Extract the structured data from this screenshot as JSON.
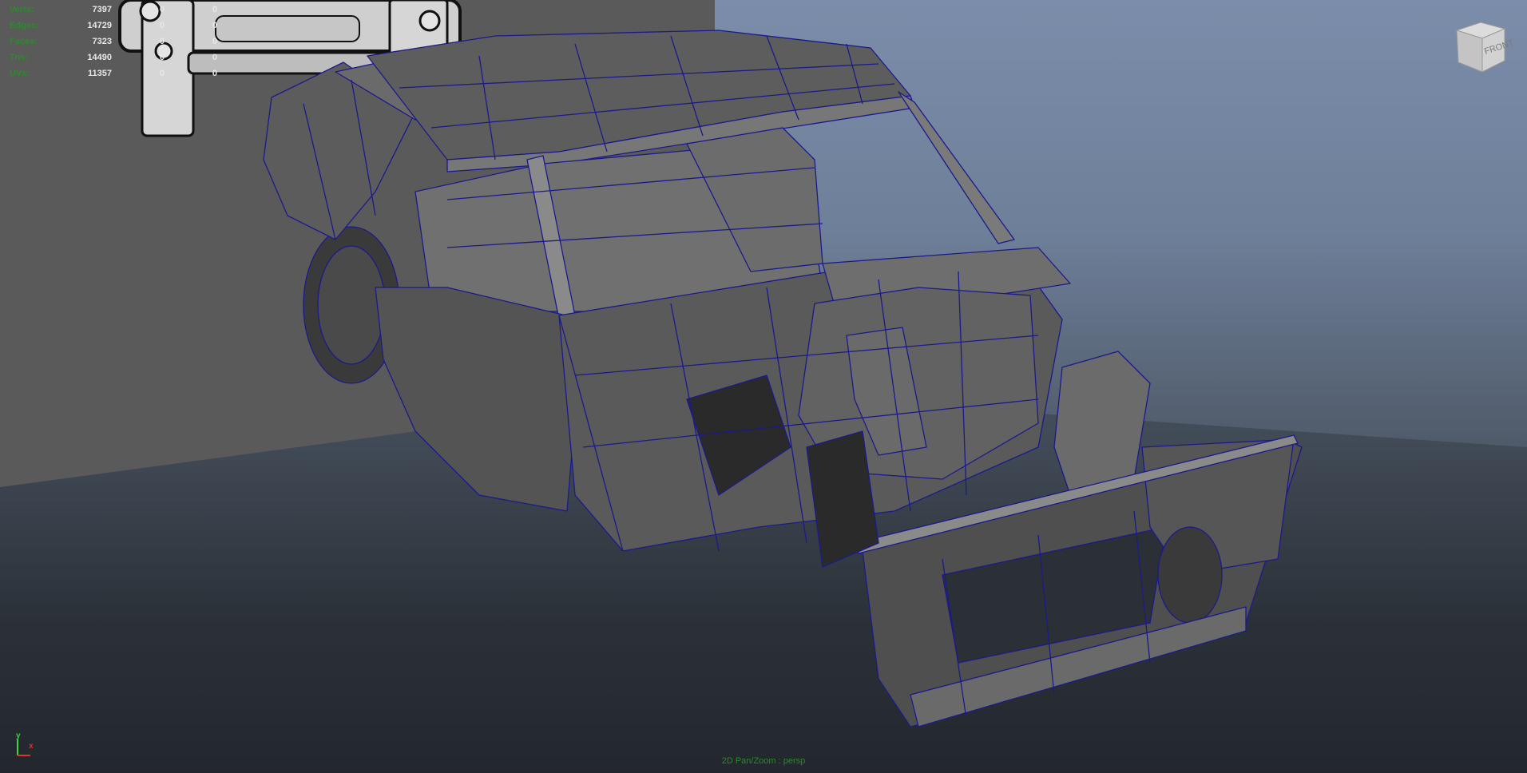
{
  "hud": {
    "rows": [
      {
        "label": "Verts:",
        "value": "7397",
        "selected": "0",
        "uv": "0"
      },
      {
        "label": "Edges:",
        "value": "14729",
        "selected": "0",
        "uv": "0"
      },
      {
        "label": "Faces:",
        "value": "7323",
        "selected": "0",
        "uv": "0"
      },
      {
        "label": "Tris:",
        "value": "14490",
        "selected": "0",
        "uv": "0"
      },
      {
        "label": "UVs:",
        "value": "11357",
        "selected": "0",
        "uv": "0"
      }
    ]
  },
  "viewcube": {
    "face_label": "FRONT"
  },
  "camera": {
    "label": "2D Pan/Zoom : persp"
  },
  "axis": {
    "y_label": "y",
    "x_label": "x"
  },
  "colors": {
    "wire": "#1a1a8c",
    "mesh_light": "#666666",
    "mesh_dark": "#2a2a2a",
    "hud_label": "#2c8a2c"
  }
}
